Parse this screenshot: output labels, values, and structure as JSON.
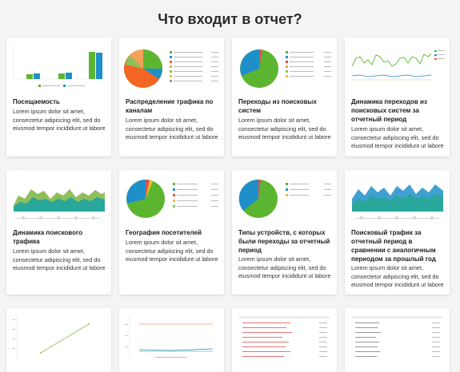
{
  "page": {
    "title": "Что входит в отчет?"
  },
  "cards": [
    {
      "title": "Посещаемость",
      "desc": "Lorem ipsum dolor sit amet, consectetur adipiscing elit, sed do eiusmod tempor incididunt ut labore"
    },
    {
      "title": "Распределение трафика по каналам",
      "desc": "Lorem ipsum dolor sit amet, consectetur adipiscing elit, sed do eiusmod tempor incididunt ut labore"
    },
    {
      "title": "Переходы из поисковых систем",
      "desc": "Lorem ipsum dolor sit amet, consectetur adipiscing elit, sed do eiusmod tempor incididunt ut labore"
    },
    {
      "title": "Динамика переходов из поисковых систем за отчетный период",
      "desc": "Lorem ipsum dolor sit amet, consectetur adipiscing elit, sed do eiusmod tempor incididunt ut labore"
    },
    {
      "title": "Динамика поискового трафика",
      "desc": "Lorem ipsum dolor sit amet, consectetur adipiscing elit, sed do eiusmod tempor incididunt ut labore"
    },
    {
      "title": "География посетителей",
      "desc": "Lorem ipsum dolor sit amet, consectetur adipiscing elit, sed do eiusmod tempor incididunt ut labore"
    },
    {
      "title": "Типы устройств, с которых были переходы за отчетный период",
      "desc": "Lorem ipsum dolor sit amet, consectetur adipiscing elit, sed do eiusmod tempor incididunt ut labore"
    },
    {
      "title": "Поисковый трафик за отчетный период в сравнении с аналогичным периодом за прошлый год",
      "desc": "Lorem ipsum dolor sit amet, consectetur adipiscing elit, sed do eiusmod tempor incididunt ut labore"
    }
  ],
  "colors": {
    "green": "#5cb531",
    "blue": "#1f8fc9",
    "orange": "#f26522",
    "teal": "#2aa79b",
    "red": "#e05050"
  }
}
